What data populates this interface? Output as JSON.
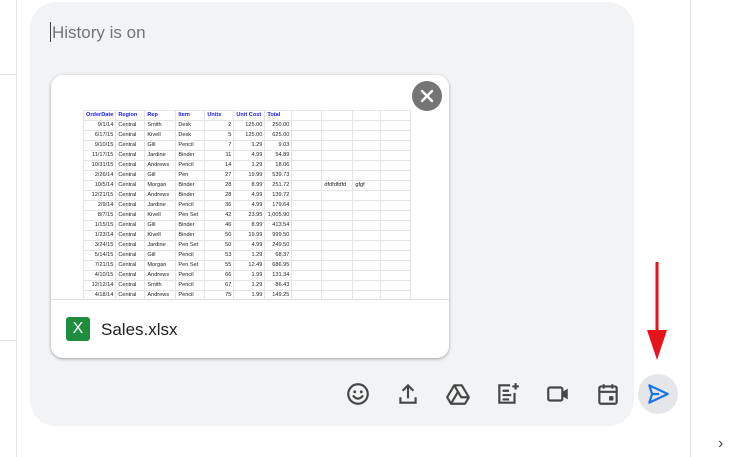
{
  "composer": {
    "placeholder": "History is on",
    "attachment": {
      "file_name": "Sales.xlsx",
      "file_icon_letter": "X",
      "preview": {
        "headers": [
          "OrderDate",
          "Region",
          "Rep",
          "Item",
          "Units",
          "Unit Cost",
          "Total"
        ],
        "rows": [
          [
            "9/1/14",
            "Central",
            "Smith",
            "Desk",
            "2",
            "125.00",
            "250.00"
          ],
          [
            "6/17/15",
            "Central",
            "Kivell",
            "Desk",
            "5",
            "125.00",
            "625.00"
          ],
          [
            "9/10/15",
            "Central",
            "Gill",
            "Pencil",
            "7",
            "1.29",
            "9.03"
          ],
          [
            "11/17/15",
            "Central",
            "Jardine",
            "Binder",
            "11",
            "4.99",
            "54.89"
          ],
          [
            "10/31/15",
            "Central",
            "Andrews",
            "Pencil",
            "14",
            "1.29",
            "18.06"
          ],
          [
            "2/26/14",
            "Central",
            "Gill",
            "Pen",
            "27",
            "19.99",
            "539.73"
          ],
          [
            "10/5/14",
            "Central",
            "Morgan",
            "Binder",
            "28",
            "8.99",
            "251.72"
          ],
          [
            "12/21/15",
            "Central",
            "Andrews",
            "Binder",
            "28",
            "4.99",
            "139.72"
          ],
          [
            "2/9/14",
            "Central",
            "Jardine",
            "Pencil",
            "36",
            "4.99",
            "179.64"
          ],
          [
            "8/7/15",
            "Central",
            "Kivell",
            "Pen Set",
            "42",
            "23.95",
            "1,005.90"
          ],
          [
            "1/15/15",
            "Central",
            "Gill",
            "Binder",
            "46",
            "8.99",
            "413.54"
          ],
          [
            "1/23/14",
            "Central",
            "Kivell",
            "Binder",
            "50",
            "19.99",
            "999.50"
          ],
          [
            "3/24/15",
            "Central",
            "Jardine",
            "Pen Set",
            "50",
            "4.99",
            "249.50"
          ],
          [
            "5/14/15",
            "Central",
            "Gill",
            "Pencil",
            "53",
            "1.29",
            "68.37"
          ],
          [
            "7/21/15",
            "Central",
            "Morgan",
            "Pen Set",
            "55",
            "12.49",
            "686.95"
          ],
          [
            "4/10/15",
            "Central",
            "Andrews",
            "Pencil",
            "66",
            "1.99",
            "131.34"
          ],
          [
            "12/12/14",
            "Central",
            "Smith",
            "Pencil",
            "67",
            "1.29",
            "86.43"
          ],
          [
            "4/18/14",
            "Central",
            "Andrews",
            "Pencil",
            "75",
            "1.99",
            "149.25"
          ],
          [
            "5/31/15",
            "Central",
            "Gill",
            "Binder",
            "80",
            "8.99",
            "719.20"
          ]
        ],
        "extra_cell": {
          "row": 6,
          "texts": [
            "dfdfdfdfd",
            "gfgf"
          ]
        }
      }
    },
    "toolbar": [
      {
        "name": "emoji-button",
        "icon": "emoji-icon"
      },
      {
        "name": "upload-file-button",
        "icon": "upload-icon"
      },
      {
        "name": "google-drive-button",
        "icon": "drive-icon"
      },
      {
        "name": "create-doc-button",
        "icon": "doc-add-icon"
      },
      {
        "name": "video-meeting-button",
        "icon": "video-icon"
      },
      {
        "name": "calendar-invite-button",
        "icon": "calendar-icon"
      },
      {
        "name": "send-button",
        "icon": "send-icon"
      }
    ],
    "colors": {
      "background": "#f1f3f4",
      "send_icon": "#1a73e8",
      "toolbar_icon": "#444746",
      "annotation_arrow": "#e8141b",
      "sheet_icon": "#1e8e3e"
    }
  }
}
